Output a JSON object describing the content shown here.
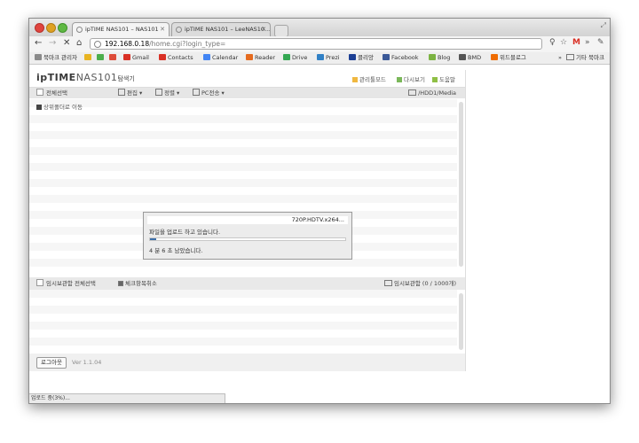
{
  "browser": {
    "tabs": [
      {
        "label": "ipTIME NAS101 – NAS101"
      },
      {
        "label": "ipTIME NAS101 – LeeNAS10..."
      }
    ],
    "url_host": "192.168.0.18",
    "url_path": "/home.cgi?login_type=",
    "bookmarks": [
      {
        "label": "북마크 관리자",
        "color": "#8a8a8a"
      },
      {
        "label": "",
        "color": "#e8b422"
      },
      {
        "label": "",
        "color": "#4cae4c"
      },
      {
        "label": "",
        "color": "#dd4b39"
      },
      {
        "label": "Gmail",
        "color": "#d93025"
      },
      {
        "label": "Contacts",
        "color": "#d93025"
      },
      {
        "label": "Calendar",
        "color": "#4285f4"
      },
      {
        "label": "Reader",
        "color": "#e56b1f"
      },
      {
        "label": "Drive",
        "color": "#34a853"
      },
      {
        "label": "Prezi",
        "color": "#3181c6"
      },
      {
        "label": "클리앙",
        "color": "#1c3f94"
      },
      {
        "label": "Facebook",
        "color": "#3b5998"
      },
      {
        "label": "Blog",
        "color": "#7cb342"
      },
      {
        "label": "BMD",
        "color": "#555555"
      },
      {
        "label": "위드블로그",
        "color": "#ef6c00"
      }
    ],
    "bookmarks_more": "»",
    "other_bookmarks": "기타 북마크",
    "status_text": "업로드 중(3%)..."
  },
  "app": {
    "logo_main": "ipTIME",
    "logo_model": "NAS101",
    "logo_sub": "탐색기",
    "header_links": [
      "관리툴모드",
      "다시보기",
      "도움말"
    ],
    "toolbar": {
      "select_all": "전체선택",
      "edit": "편집",
      "sort": "정렬",
      "pc_transfer": "PC전송",
      "path": "/HDD1/Media"
    },
    "up_folder": "상위폴더로 이동",
    "upload_dialog": {
      "filename": "720P.HDTV.x264...",
      "message": "파일을 업로드 하고 있습니다.",
      "progress": 0.03,
      "time_left": "4 분 6 초 남았습니다."
    },
    "temp_bar": {
      "select_all": "임시보관함 전체선택",
      "uncheck": "체크항목취소",
      "temp_label": "임시보관함 (0 / 1000개)"
    },
    "logout": "로그아웃",
    "version": "Ver 1.1.04"
  },
  "colors": {
    "progress_fill": "#3d6fa8",
    "logo_accent": "#3a3a3a"
  }
}
